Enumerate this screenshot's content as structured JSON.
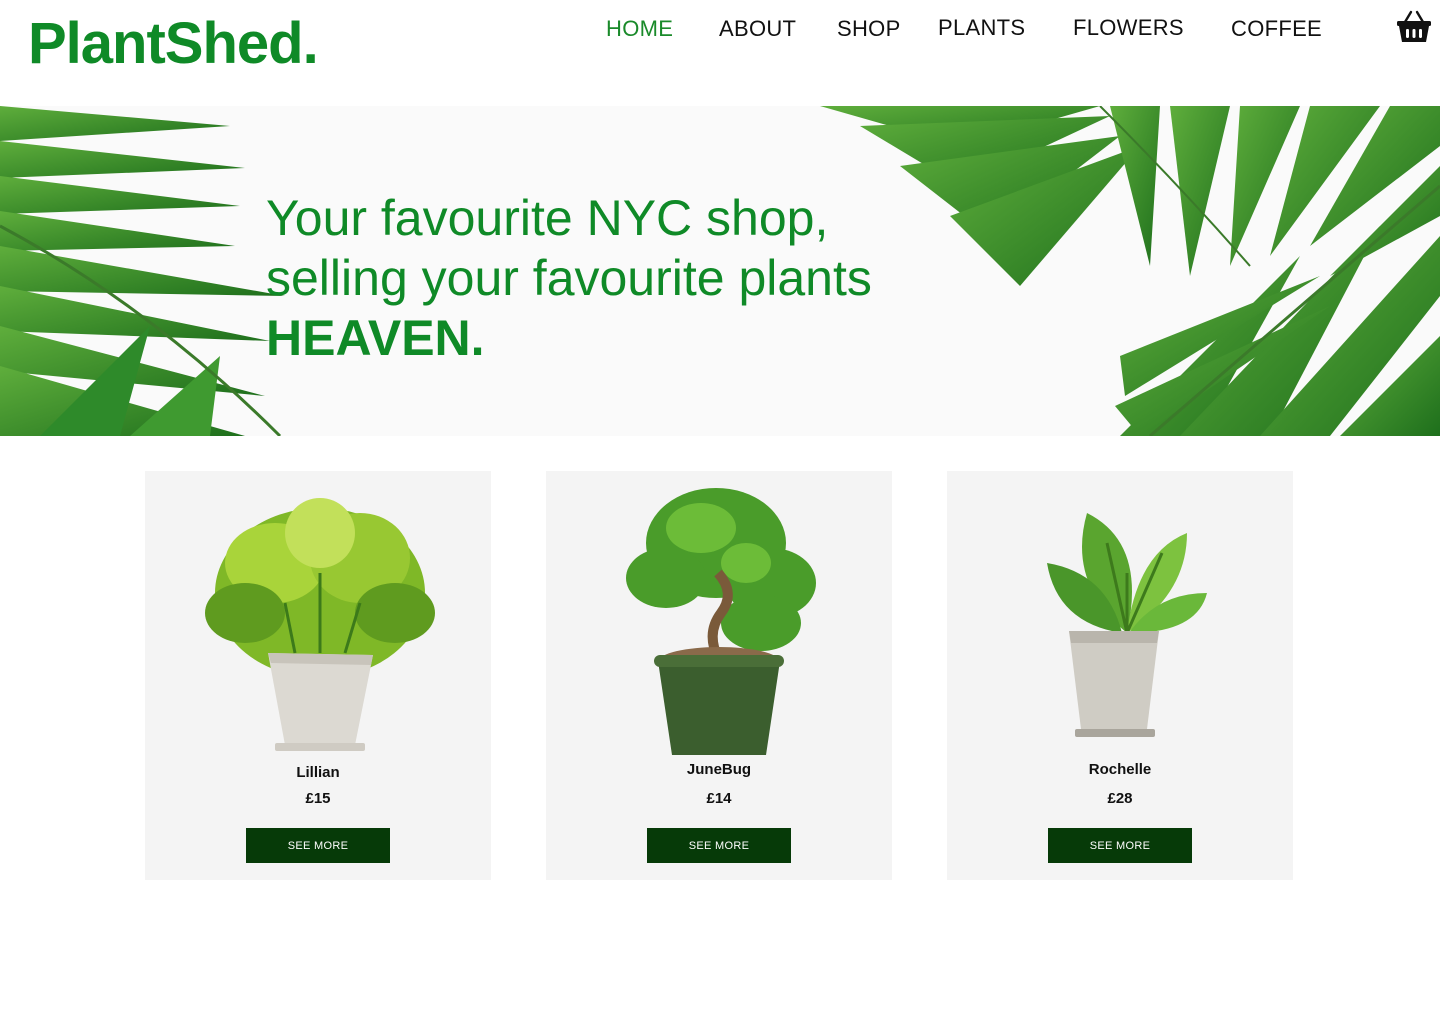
{
  "brand": {
    "logo": "PlantShed."
  },
  "nav": {
    "items": [
      {
        "label": "HOME",
        "active": true
      },
      {
        "label": "ABOUT",
        "active": false
      },
      {
        "label": "SHOP",
        "active": false
      },
      {
        "label": "PLANTS",
        "active": false
      },
      {
        "label": "FLOWERS",
        "active": false
      },
      {
        "label": "COFFEE",
        "active": false
      }
    ],
    "basket_icon": "basket-icon"
  },
  "hero": {
    "line1": "Your favourite NYC shop,",
    "line2": "selling your favourite plants",
    "line3": "HEAVEN."
  },
  "products": [
    {
      "name": "Lillian",
      "price": "£15",
      "button": "SEE MORE",
      "icon": "dieffenbachia-plant-image"
    },
    {
      "name": "JuneBug",
      "price": "£14",
      "button": "SEE MORE",
      "icon": "bonsai-plant-image"
    },
    {
      "name": "Rochelle",
      "price": "£28",
      "button": "SEE MORE",
      "icon": "anthurium-plant-image"
    }
  ],
  "colors": {
    "brand_green": "#0f8a27",
    "button_green": "#063a08",
    "card_bg": "#f4f4f4"
  }
}
